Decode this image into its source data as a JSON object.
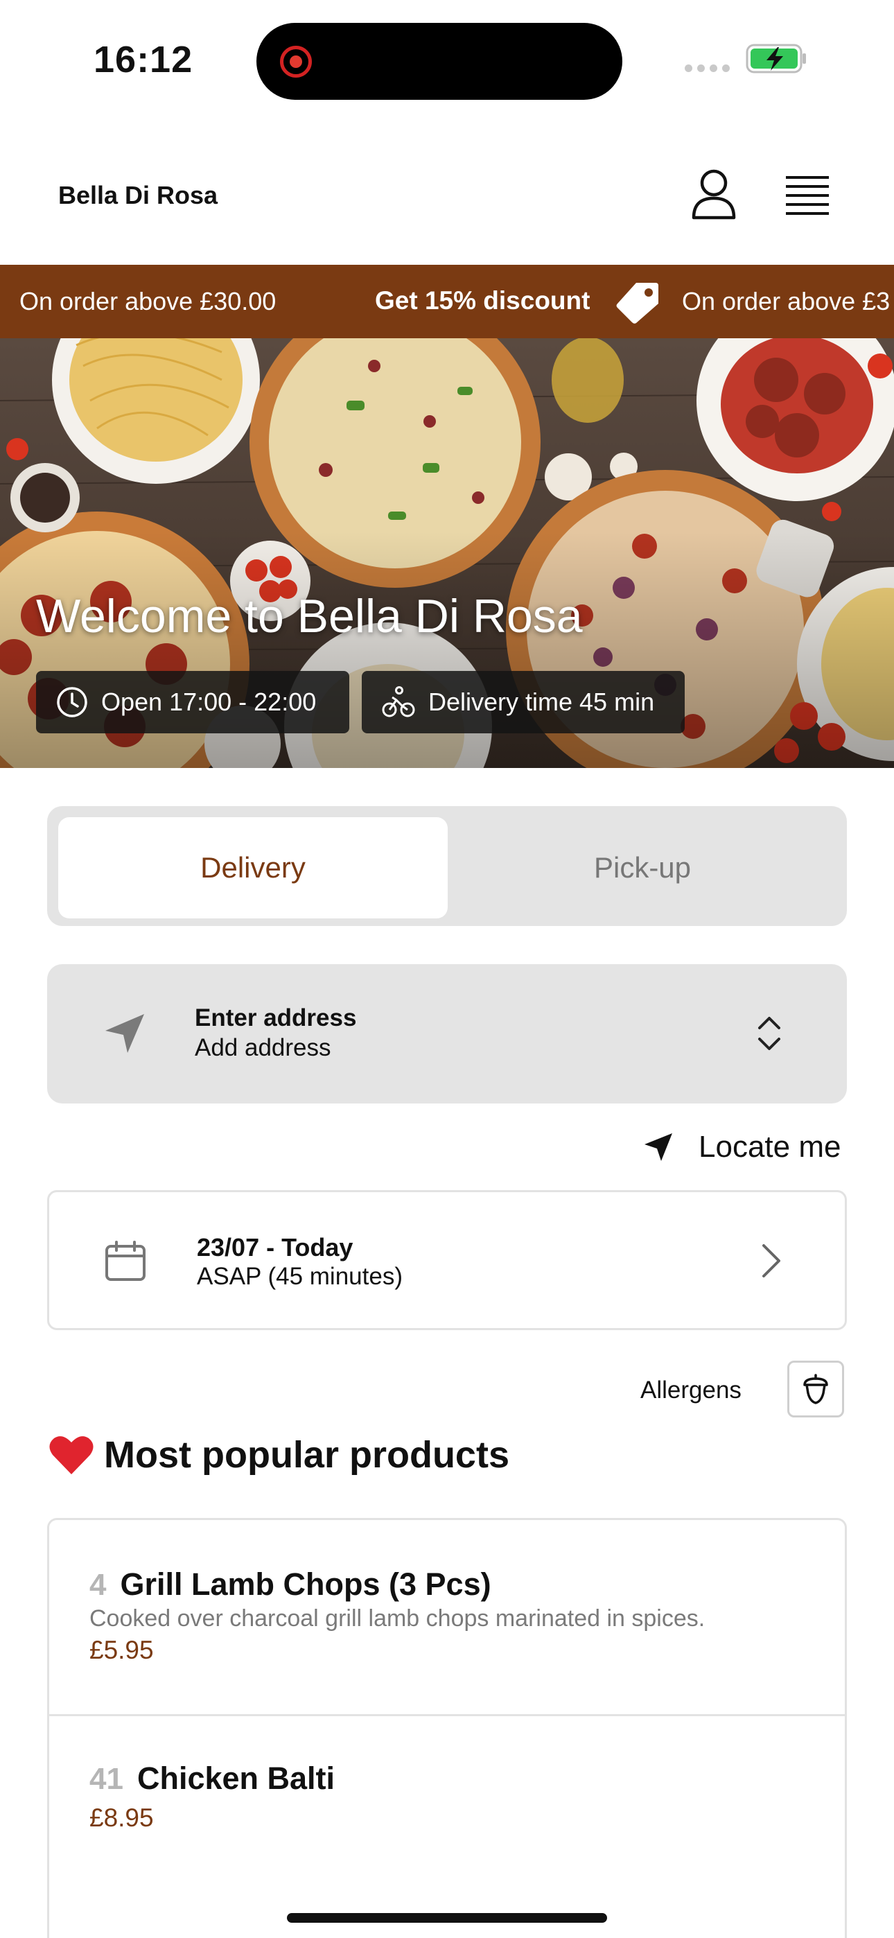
{
  "status_bar": {
    "time": "16:12"
  },
  "header": {
    "brand": "Bella Di Rosa"
  },
  "promo": {
    "text_left": "On order above £30.00",
    "text_center": "Get 15% discount",
    "text_right": "On order above £3"
  },
  "hero": {
    "title": "Welcome to Bella Di Rosa",
    "opening_hours": "Open 17:00 - 22:00",
    "delivery_time": "Delivery time 45 min"
  },
  "order_mode": {
    "delivery_label": "Delivery",
    "pickup_label": "Pick-up",
    "selected": "Delivery"
  },
  "address": {
    "title": "Enter address",
    "subtitle": "Add address",
    "locate_label": "Locate me"
  },
  "schedule": {
    "date": "23/07 - Today",
    "time": "ASAP (45 minutes)"
  },
  "allergens": {
    "label": "Allergens"
  },
  "popular": {
    "title": "Most popular products",
    "products": [
      {
        "number": "4",
        "name": "Grill Lamb Chops (3 Pcs)",
        "description": "Cooked over charcoal grill lamb chops marinated in spices.",
        "price": "£5.95"
      },
      {
        "number": "41",
        "name": "Chicken Balti",
        "description": "",
        "price": "£8.95"
      }
    ]
  },
  "colors": {
    "brand": "#7a3a12",
    "surface": "#e4e4e4",
    "muted": "#7a7a7a"
  },
  "icons": [
    "clock-icon",
    "bike-icon",
    "navigation-arrow-icon",
    "expand-icon",
    "locate-arrow-icon",
    "calendar-icon",
    "chevron-right-icon",
    "acorn-icon",
    "heart-icon",
    "user-icon",
    "menu-icon",
    "tag-icon"
  ]
}
